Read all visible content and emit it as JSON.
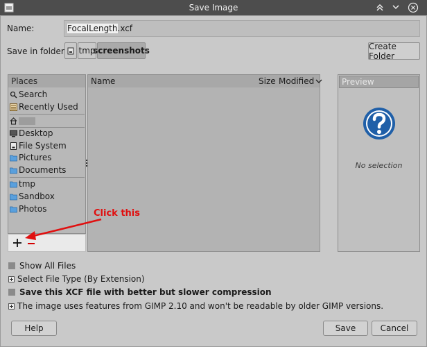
{
  "window": {
    "title": "Save Image"
  },
  "name": {
    "label": "Name:",
    "value_selected": "FocalLength",
    "value_ext": ".xcf"
  },
  "save_in": {
    "label": "Save in folder:",
    "crumbs": [
      "tmp",
      "screenshots"
    ],
    "create_folder": "Create Folder"
  },
  "places": {
    "header": "Places",
    "items": [
      "Search",
      "Recently Used",
      "Desktop",
      "File System",
      "Pictures",
      "Documents",
      "tmp",
      "Sandbox",
      "Photos"
    ]
  },
  "files": {
    "col_name": "Name",
    "col_size": "Size",
    "col_modified": "Modified"
  },
  "preview": {
    "header": "Preview",
    "empty": "No selection"
  },
  "annotation": {
    "text": "Click this",
    "color": "#e01010"
  },
  "options": {
    "show_all_files": "Show All Files",
    "select_file_type": "Select File Type (By Extension)",
    "save_xcf": "Save this XCF file with better but slower compression",
    "compat": "The image uses features from GIMP 2.10 and won't be readable by older GIMP versions."
  },
  "buttons": {
    "help": "Help",
    "save": "Save",
    "cancel": "Cancel"
  },
  "icons": {
    "app": "gimp-icon",
    "window_buttons": [
      "keep-above-icon",
      "keep-below-icon",
      "close-icon"
    ],
    "help": "question-icon"
  },
  "colors": {
    "accent": "#1f5fa8",
    "titlebar": "#4d4d4d",
    "annotation": "#e01010"
  }
}
